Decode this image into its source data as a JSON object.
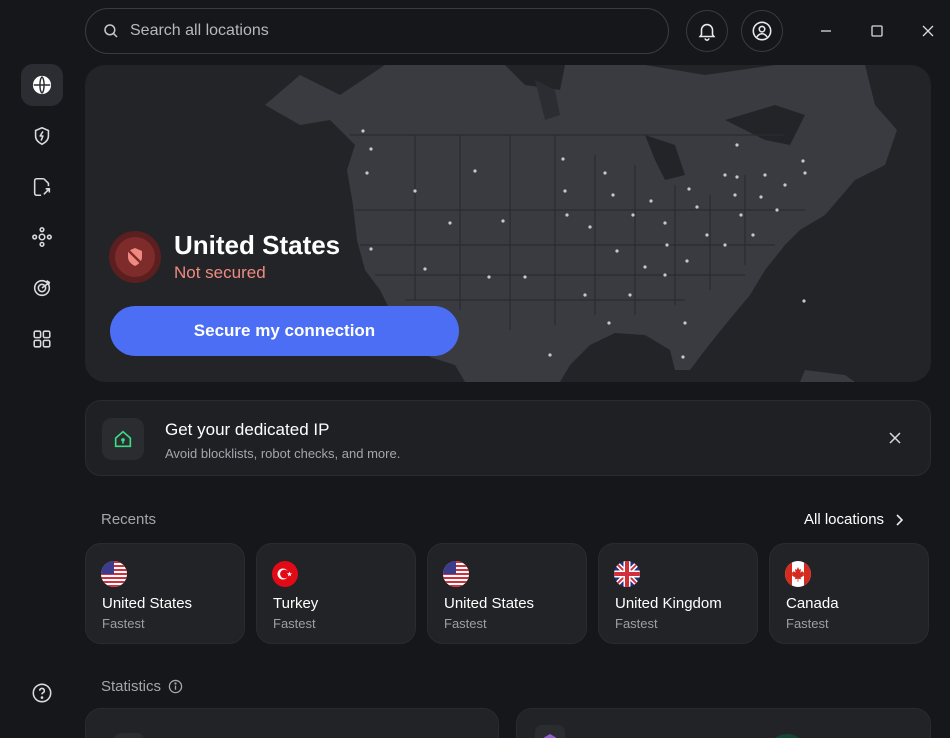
{
  "search": {
    "placeholder": "Search all locations"
  },
  "sidebar": {
    "items": [
      {
        "icon": "globe-icon",
        "active": true
      },
      {
        "icon": "shield-bolt-icon"
      },
      {
        "icon": "split-tunnel-icon"
      },
      {
        "icon": "mesh-network-icon"
      },
      {
        "icon": "target-icon"
      },
      {
        "icon": "apps-grid-icon"
      }
    ],
    "help_icon": "help-icon"
  },
  "connection": {
    "country": "United States",
    "status": "Not secured",
    "button_label": "Secure my connection"
  },
  "banner": {
    "title": "Get your dedicated IP",
    "subtitle": "Avoid blocklists, robot checks, and more."
  },
  "recents": {
    "label": "Recents",
    "all_locations": "All locations",
    "items": [
      {
        "name": "United States",
        "sub": "Fastest",
        "flag": "us"
      },
      {
        "name": "Turkey",
        "sub": "Fastest",
        "flag": "tr"
      },
      {
        "name": "United States",
        "sub": "Fastest",
        "flag": "us"
      },
      {
        "name": "United Kingdom",
        "sub": "Fastest",
        "flag": "uk"
      },
      {
        "name": "Canada",
        "sub": "Fastest",
        "flag": "ca"
      }
    ]
  },
  "statistics": {
    "label": "Statistics"
  },
  "colors": {
    "accent": "#4c6ef5",
    "danger": "#f08a80",
    "background": "#16171a",
    "card": "#232428"
  }
}
